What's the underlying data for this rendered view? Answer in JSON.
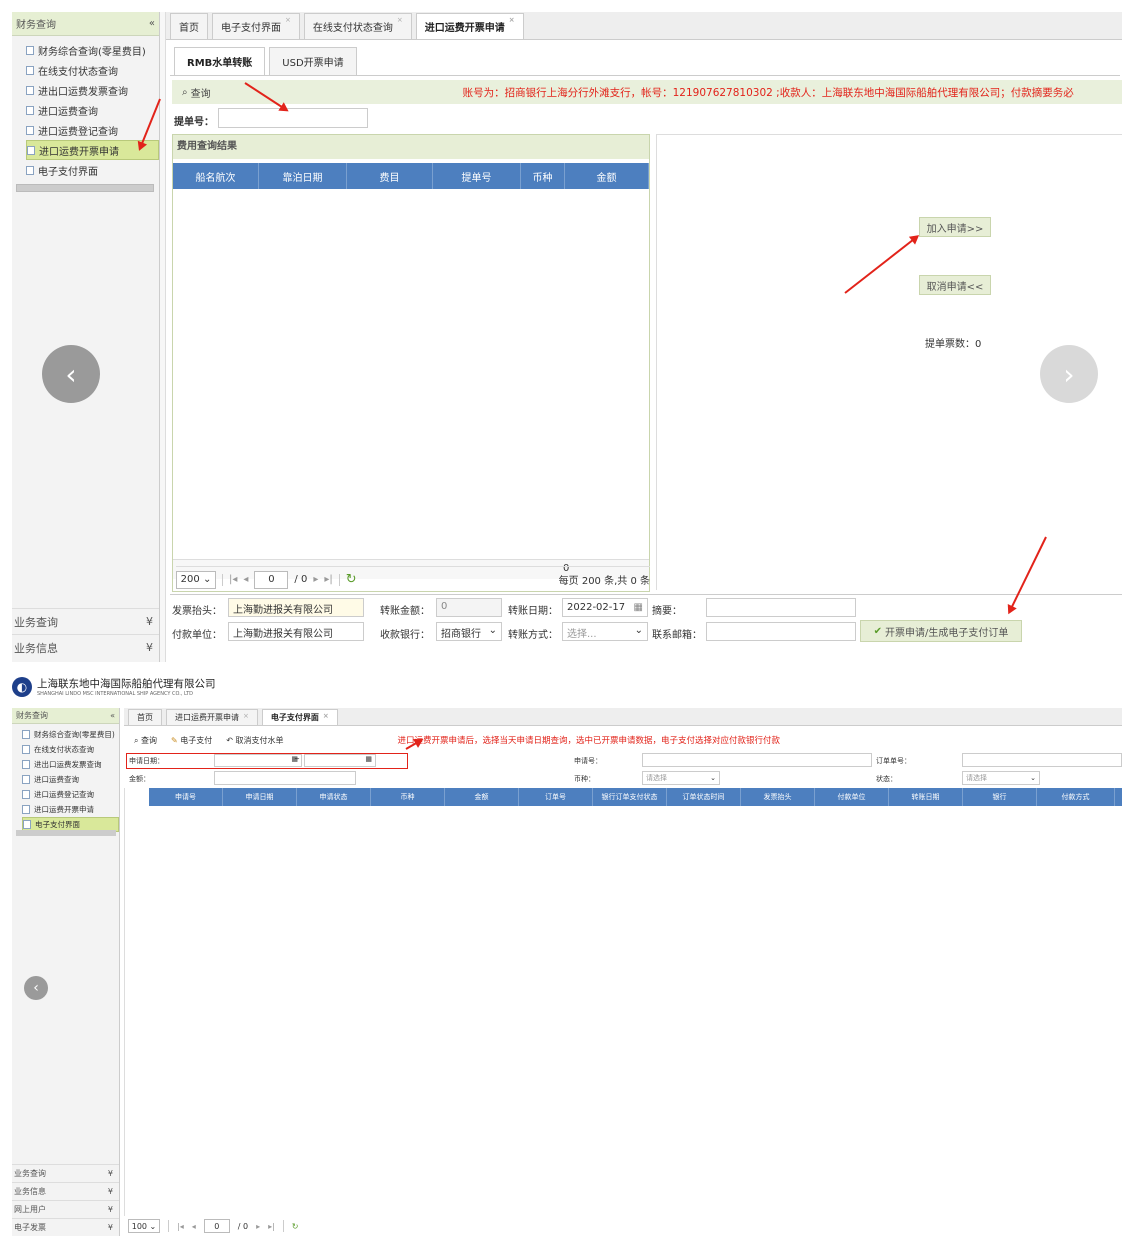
{
  "top": {
    "sidebar": {
      "title": "财务查询",
      "collapse_icon": "«",
      "items": [
        {
          "label": "财务综合查询(零星费目)"
        },
        {
          "label": "在线支付状态查询"
        },
        {
          "label": "进出口运费发票查询"
        },
        {
          "label": "进口运费查询"
        },
        {
          "label": "进口运费登记查询"
        },
        {
          "label": "进口运费开票申请",
          "selected": true
        },
        {
          "label": "电子支付界面"
        }
      ],
      "bottom": [
        {
          "label": "业务查询",
          "icon": "¥"
        },
        {
          "label": "业务信息",
          "icon": "¥"
        }
      ]
    },
    "tabs": [
      {
        "label": "首页",
        "closable": false
      },
      {
        "label": "电子支付界面",
        "closable": true
      },
      {
        "label": "在线支付状态查询",
        "closable": true
      },
      {
        "label": "进口运费开票申请",
        "closable": true,
        "active": true
      }
    ],
    "subtabs": [
      {
        "label": "RMB水单转账",
        "active": true
      },
      {
        "label": "USD开票申请"
      }
    ],
    "query_button": "查询",
    "account_notice": "账号为：招商银行上海分行外滩支行，帐号：121907627810302 ;收款人：上海联东地中海国际船舶代理有限公司；付款摘要务必",
    "bill_no_label": "提单号：",
    "results_title": "费用查询结果",
    "columns": [
      "船名航次",
      "靠泊日期",
      "费目",
      "提单号",
      "币种",
      "金额"
    ],
    "footer_total": "0",
    "pager": {
      "page_size": "200",
      "page": "0",
      "total_pages": "/ 0",
      "summary": "每页 200 条,共 0 条"
    },
    "add_button": "加入申请>>",
    "cancel_button": "取消申请<<",
    "count_label": "提单票数：",
    "count_value": "0",
    "form": {
      "invoice_title_label": "发票抬头：",
      "invoice_title_value": "上海勤进报关有限公司",
      "transfer_amount_label": "转账金额：",
      "transfer_amount_value": "0",
      "transfer_date_label": "转账日期：",
      "transfer_date_value": "2022-02-17",
      "summary_label": "摘要：",
      "payer_label": "付款单位：",
      "payer_value": "上海勤进报关有限公司",
      "bank_label": "收款银行：",
      "bank_value": "招商银行",
      "method_label": "转账方式：",
      "method_placeholder": "选择...",
      "email_label": "联系邮箱：",
      "submit_button": "开票申请/生成电子支付订单"
    }
  },
  "bottom": {
    "company_name": "上海联东地中海国际船舶代理有限公司",
    "company_en": "SHANGHAI LINDO MSC INTERNATIONAL SHIP AGENCY CO., LTD",
    "sidebar": {
      "title": "财务查询",
      "collapse_icon": "«",
      "items": [
        {
          "label": "财务综合查询(零星费目)"
        },
        {
          "label": "在线支付状态查询"
        },
        {
          "label": "进出口运费发票查询"
        },
        {
          "label": "进口运费查询"
        },
        {
          "label": "进口运费登记查询"
        },
        {
          "label": "进口运费开票申请"
        },
        {
          "label": "电子支付界面",
          "selected": true
        }
      ],
      "bottom": [
        {
          "label": "业务查询",
          "icon": "¥"
        },
        {
          "label": "业务信息",
          "icon": "¥"
        },
        {
          "label": "网上用户",
          "icon": "¥"
        },
        {
          "label": "电子发票",
          "icon": "¥"
        }
      ]
    },
    "tabs": [
      {
        "label": "首页",
        "closable": false
      },
      {
        "label": "进口运费开票申请",
        "closable": true
      },
      {
        "label": "电子支付界面",
        "closable": true,
        "active": true
      }
    ],
    "toolbar": {
      "query": "查询",
      "pay": "电子支付",
      "cancel": "取消支付水单"
    },
    "instruction": "进口运费开票申请后，选择当天申请日期查询，选中已开票申请数据，电子支付选择对应付款银行付款",
    "filters": {
      "apply_date_label": "申请日期：",
      "range_sep": "~",
      "apply_no_label": "申请号：",
      "order_no_label": "订单单号：",
      "amount_label": "金额：",
      "currency_label": "币种：",
      "currency_placeholder": "请选择",
      "status_label": "状态：",
      "status_placeholder": "请选择"
    },
    "columns": [
      "申请号",
      "申请日期",
      "申请状态",
      "币种",
      "金额",
      "订单号",
      "银行订单支付状态",
      "订单状态时间",
      "发票抬头",
      "付款单位",
      "转账日期",
      "银行",
      "付款方式"
    ],
    "pager": {
      "page_size": "100",
      "page": "0",
      "total_pages": "/ 0"
    }
  }
}
